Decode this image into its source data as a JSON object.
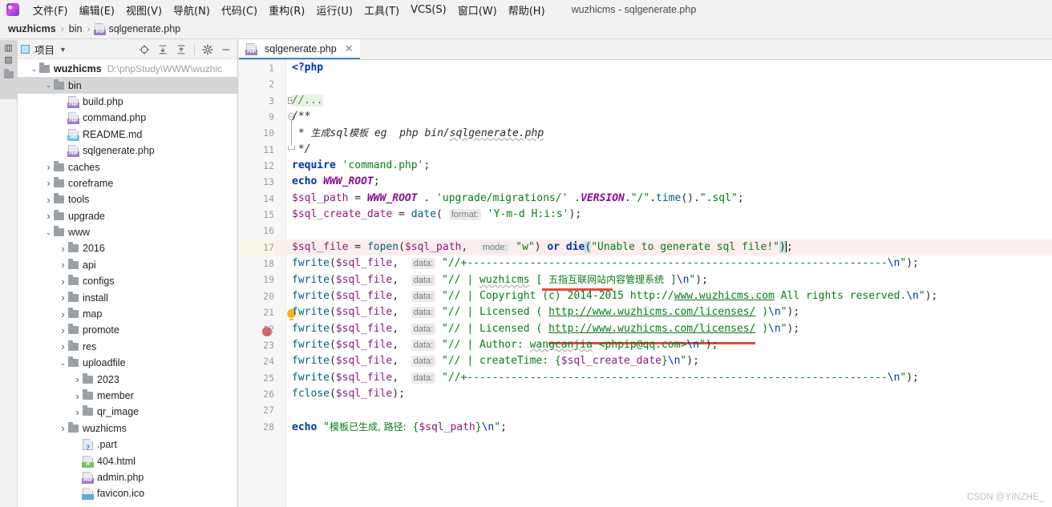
{
  "window": {
    "title": "wuzhicms - sqlgenerate.php",
    "logo_icon": "phpstorm-logo-icon"
  },
  "menubar": {
    "items": [
      {
        "label": "文件(F)",
        "mnemonic": "F"
      },
      {
        "label": "编辑(E)",
        "mnemonic": "E"
      },
      {
        "label": "视图(V)",
        "mnemonic": "V"
      },
      {
        "label": "导航(N)",
        "mnemonic": "N"
      },
      {
        "label": "代码(C)",
        "mnemonic": "C"
      },
      {
        "label": "重构(R)",
        "mnemonic": "R"
      },
      {
        "label": "运行(U)",
        "mnemonic": "U"
      },
      {
        "label": "工具(T)",
        "mnemonic": "T"
      },
      {
        "label": "VCS(S)",
        "mnemonic": "S"
      },
      {
        "label": "窗口(W)",
        "mnemonic": "W"
      },
      {
        "label": "帮助(H)",
        "mnemonic": "H"
      }
    ]
  },
  "breadcrumb": {
    "items": [
      "wuzhicms",
      "bin",
      "sqlgenerate.php"
    ],
    "separator": "›",
    "file_icon": "php-file-icon"
  },
  "stripe": {
    "project_button_label": "项目",
    "folder_icon": "folder-icon"
  },
  "project_panel": {
    "title": "项目",
    "title_icon": "project-window-icon",
    "dropdown_icon": "chevron-down-icon",
    "toolbar_icons": [
      "select-opened-file-icon",
      "expand-all-icon",
      "collapse-all-icon",
      "settings-gear-icon",
      "hide-panel-icon"
    ],
    "tree": [
      {
        "label": "wuzhicms",
        "path": "D:\\phpStudy\\WWW\\wuzhic",
        "depth": 0,
        "arrow": "v",
        "icon": "folder-icon",
        "bold": true,
        "selected": false
      },
      {
        "label": "bin",
        "depth": 1,
        "arrow": "v",
        "icon": "folder-icon",
        "selected": true
      },
      {
        "label": "build.php",
        "depth": 2,
        "arrow": "",
        "icon": "php-file-icon"
      },
      {
        "label": "command.php",
        "depth": 2,
        "arrow": "",
        "icon": "php-file-icon"
      },
      {
        "label": "README.md",
        "depth": 2,
        "arrow": "",
        "icon": "md-file-icon"
      },
      {
        "label": "sqlgenerate.php",
        "depth": 2,
        "arrow": "",
        "icon": "php-file-icon"
      },
      {
        "label": "caches",
        "depth": 1,
        "arrow": ">",
        "icon": "folder-icon"
      },
      {
        "label": "coreframe",
        "depth": 1,
        "arrow": ">",
        "icon": "folder-icon"
      },
      {
        "label": "tools",
        "depth": 1,
        "arrow": ">",
        "icon": "folder-icon"
      },
      {
        "label": "upgrade",
        "depth": 1,
        "arrow": ">",
        "icon": "folder-icon"
      },
      {
        "label": "www",
        "depth": 1,
        "arrow": "v",
        "icon": "folder-icon"
      },
      {
        "label": "2016",
        "depth": 2,
        "arrow": ">",
        "icon": "folder-icon"
      },
      {
        "label": "api",
        "depth": 2,
        "arrow": ">",
        "icon": "folder-icon"
      },
      {
        "label": "configs",
        "depth": 2,
        "arrow": ">",
        "icon": "folder-icon"
      },
      {
        "label": "install",
        "depth": 2,
        "arrow": ">",
        "icon": "folder-icon"
      },
      {
        "label": "map",
        "depth": 2,
        "arrow": ">",
        "icon": "folder-icon"
      },
      {
        "label": "promote",
        "depth": 2,
        "arrow": ">",
        "icon": "folder-icon"
      },
      {
        "label": "res",
        "depth": 2,
        "arrow": ">",
        "icon": "folder-icon"
      },
      {
        "label": "uploadfile",
        "depth": 2,
        "arrow": "v",
        "icon": "folder-icon"
      },
      {
        "label": "2023",
        "depth": 3,
        "arrow": ">",
        "icon": "folder-icon"
      },
      {
        "label": "member",
        "depth": 3,
        "arrow": ">",
        "icon": "folder-icon"
      },
      {
        "label": "qr_image",
        "depth": 3,
        "arrow": ">",
        "icon": "folder-icon"
      },
      {
        "label": "wuzhicms",
        "depth": 2,
        "arrow": ">",
        "icon": "folder-icon"
      },
      {
        "label": ".part",
        "depth": 3,
        "arrow": "",
        "icon": "unknown-file-icon"
      },
      {
        "label": "404.html",
        "depth": 3,
        "arrow": "",
        "icon": "html-file-icon"
      },
      {
        "label": "admin.php",
        "depth": 3,
        "arrow": "",
        "icon": "php-file-icon"
      },
      {
        "label": "favicon.ico",
        "depth": 3,
        "arrow": "",
        "icon": "image-file-icon"
      }
    ]
  },
  "editor": {
    "tab": {
      "label": "sqlgenerate.php",
      "icon": "php-file-icon",
      "close_icon": "close-icon",
      "active": true
    },
    "line_numbers": [
      "1",
      "2",
      "3",
      "9",
      "10",
      "11",
      "12",
      "13",
      "14",
      "15",
      "16",
      "17",
      "18",
      "19",
      "20",
      "21",
      "22",
      "23",
      "24",
      "25",
      "26",
      "27",
      "28"
    ],
    "gutter_markers": {
      "breakpoint_line": "17",
      "intention_bulb_line": "16",
      "fold_plus_line": "3",
      "fold_minus_line": "9"
    },
    "lines": [
      {
        "no": "1",
        "text": "<?php"
      },
      {
        "no": "2",
        "text": ""
      },
      {
        "no": "3",
        "text": "//..."
      },
      {
        "no": "9",
        "text": "/**"
      },
      {
        "no": "10",
        "text": " * 生成sql模板 eg  php bin/sqlgenerate.php"
      },
      {
        "no": "11",
        "text": " */"
      },
      {
        "no": "12",
        "text": "require 'command.php';"
      },
      {
        "no": "13",
        "text": "echo WWW_ROOT;"
      },
      {
        "no": "14",
        "text": "$sql_path = WWW_ROOT . 'upgrade/migrations/' .VERSION.\"/\".time().\".sql\";"
      },
      {
        "no": "15",
        "text": "$sql_create_date = date( format: 'Y-m-d H:i:s');"
      },
      {
        "no": "16",
        "text": ""
      },
      {
        "no": "17",
        "text": "$sql_file = fopen($sql_path,  mode: \"w\") or die(\"Unable to generate sql file!\");"
      },
      {
        "no": "18",
        "text": "fwrite($sql_file,  data: \"//+-------------------------------------------------------------------\\n\");"
      },
      {
        "no": "19",
        "text": "fwrite($sql_file,  data: \"// | wuzhicms [ 五指互联网站内容管理系统 ]\\n\");"
      },
      {
        "no": "20",
        "text": "fwrite($sql_file,  data: \"// | Copyright (c) 2014-2015 http://www.wuzhicms.com All rights reserved.\\n\");"
      },
      {
        "no": "21",
        "text": "fwrite($sql_file,  data: \"// | Licensed ( http://www.wuzhicms.com/licenses/ )\\n\");"
      },
      {
        "no": "22",
        "text": "fwrite($sql_file,  data: \"// | Licensed ( http://www.wuzhicms.com/licenses/ )\\n\");"
      },
      {
        "no": "23",
        "text": "fwrite($sql_file,  data: \"// | Author: wangcanjia <phpip@qq.com>\\n\");"
      },
      {
        "no": "24",
        "text": "fwrite($sql_file,  data: \"// | createTime: {$sql_create_date}\\n\");"
      },
      {
        "no": "25",
        "text": "fwrite($sql_file,  data: \"//+-------------------------------------------------------------------\\n\");"
      },
      {
        "no": "26",
        "text": "fclose($sql_file);"
      },
      {
        "no": "27",
        "text": ""
      },
      {
        "no": "28",
        "text": "echo \"模板已生成, 路径: {$sql_path}\\n\";"
      }
    ],
    "parameter_hints": [
      "format:",
      "mode:",
      "data:"
    ],
    "error_underline_targets": [
      "$sql_path",
      "fopen($sql_path,"
    ]
  },
  "watermark": "CSDN @YINZHE_",
  "colors": {
    "accent": "#4a88c7",
    "error": "#e8483f",
    "breakpoint": "#db5c5c",
    "bulb": "#f5b721",
    "string": "#067d17",
    "keyword": "#0033b3",
    "variable": "#871094",
    "function": "#00627a",
    "comment": "#8c8c8c",
    "current_line_bg": "#fdeeee",
    "selection": "#bfe8df",
    "panel_bg": "#f2f2f2",
    "tree_selected": "#d6d6d6"
  }
}
